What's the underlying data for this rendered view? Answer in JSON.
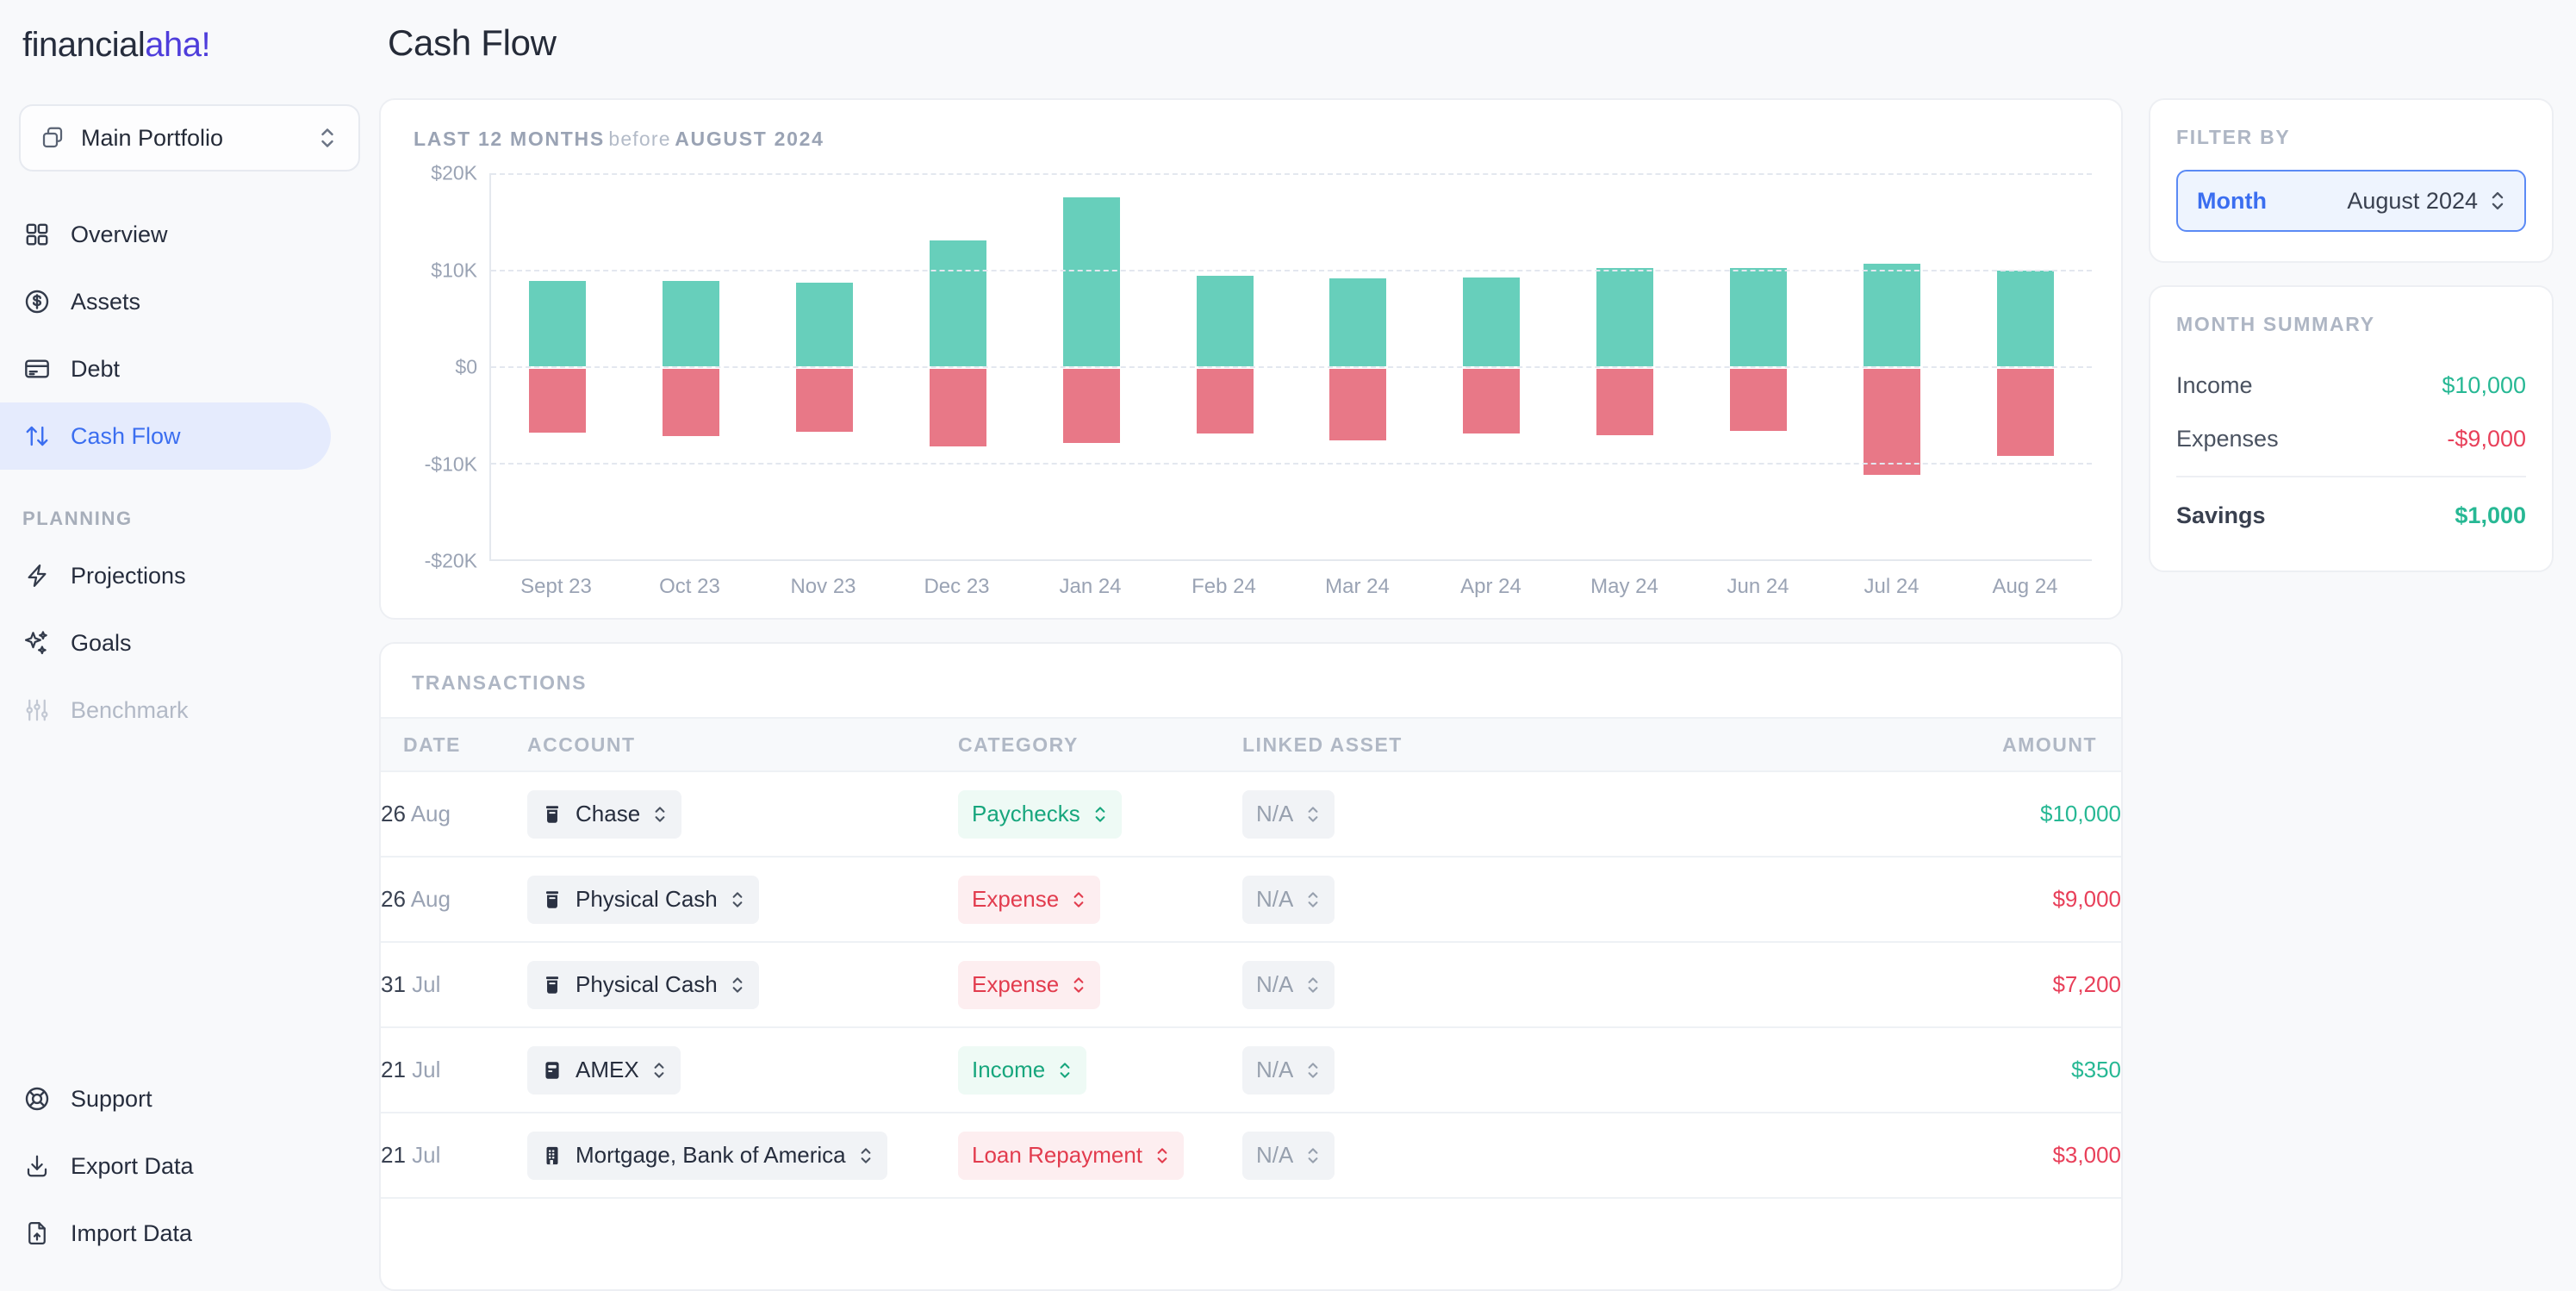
{
  "brand": {
    "name_part1": "financial",
    "name_part2": "aha!"
  },
  "portfolio_selector": {
    "label": "Main Portfolio",
    "icon": "copy-icon"
  },
  "sidebar": {
    "main_items": [
      {
        "label": "Overview",
        "icon": "grid-icon",
        "active": false
      },
      {
        "label": "Assets",
        "icon": "dollar-circle-icon",
        "active": false
      },
      {
        "label": "Debt",
        "icon": "credit-card-icon",
        "active": false
      },
      {
        "label": "Cash Flow",
        "icon": "arrows-up-down-icon",
        "active": true
      }
    ],
    "planning_title": "PLANNING",
    "planning_items": [
      {
        "label": "Projections",
        "icon": "lightning-icon",
        "disabled": false
      },
      {
        "label": "Goals",
        "icon": "sparkles-icon",
        "disabled": false
      },
      {
        "label": "Benchmark",
        "icon": "sliders-icon",
        "disabled": true
      }
    ],
    "bottom_items": [
      {
        "label": "Support",
        "icon": "lifebuoy-icon"
      },
      {
        "label": "Export Data",
        "icon": "download-icon"
      },
      {
        "label": "Import Data",
        "icon": "file-upload-icon"
      }
    ]
  },
  "header": {
    "page_title": "Cash Flow"
  },
  "chart_card": {
    "period_prefix": "LAST 12 MONTHS",
    "period_middle": "before",
    "period_suffix": "AUGUST 2024"
  },
  "chart_data": {
    "type": "bar",
    "title": "LAST 12 MONTHS before AUGUST 2024",
    "subtitle": "",
    "xlabel": "",
    "ylabel": "",
    "ylim": [
      -20000,
      20000
    ],
    "ytick_labels": [
      "$20K",
      "$10K",
      "$0",
      "-$10K",
      "-$20K"
    ],
    "ytick_values": [
      20000,
      10000,
      0,
      -10000,
      -20000
    ],
    "grid": true,
    "legend": "none",
    "stacked": "diverging",
    "categories": [
      "Sept 23",
      "Oct 23",
      "Nov 23",
      "Dec 23",
      "Jan 24",
      "Feb 24",
      "Mar 24",
      "Apr 24",
      "May 24",
      "Jun 24",
      "Jul 24",
      "Aug 24"
    ],
    "series": [
      {
        "name": "Income",
        "color": "#67cfbb",
        "values": [
          8800,
          8800,
          8700,
          13000,
          17500,
          9400,
          9100,
          9200,
          10200,
          10200,
          10600,
          9900
        ]
      },
      {
        "name": "Expenses",
        "color": "#e87887",
        "values": [
          -6600,
          -7000,
          -6500,
          -8000,
          -7700,
          -6700,
          -7400,
          -6700,
          -6900,
          -6400,
          -11000,
          -9000
        ]
      }
    ]
  },
  "transactions_card": {
    "title": "TRANSACTIONS",
    "columns": [
      "DATE",
      "ACCOUNT",
      "CATEGORY",
      "LINKED ASSET",
      "AMOUNT"
    ],
    "rows": [
      {
        "day": "26",
        "month": "Aug",
        "account": "Chase",
        "account_icon": "jar-icon",
        "category": "Paychecks",
        "category_type": "income",
        "linked_asset": "N/A",
        "amount": "$10,000",
        "amount_type": "positive"
      },
      {
        "day": "26",
        "month": "Aug",
        "account": "Physical Cash",
        "account_icon": "jar-icon",
        "category": "Expense",
        "category_type": "expense",
        "linked_asset": "N/A",
        "amount": "$9,000",
        "amount_type": "negative"
      },
      {
        "day": "31",
        "month": "Jul",
        "account": "Physical Cash",
        "account_icon": "jar-icon",
        "category": "Expense",
        "category_type": "expense",
        "linked_asset": "N/A",
        "amount": "$7,200",
        "amount_type": "negative"
      },
      {
        "day": "21",
        "month": "Jul",
        "account": "AMEX",
        "account_icon": "credit-card-icon",
        "category": "Income",
        "category_type": "income",
        "linked_asset": "N/A",
        "amount": "$350",
        "amount_type": "positive"
      },
      {
        "day": "21",
        "month": "Jul",
        "account": "Mortgage, Bank of America",
        "account_icon": "bank-icon",
        "category": "Loan Repayment",
        "category_type": "expense",
        "linked_asset": "N/A",
        "amount": "$3,000",
        "amount_type": "negative"
      }
    ]
  },
  "filter_panel": {
    "title": "FILTER BY",
    "filter_key": "Month",
    "filter_value": "August 2024"
  },
  "summary_panel": {
    "title": "MONTH SUMMARY",
    "income_label": "Income",
    "income_value": "$10,000",
    "expenses_label": "Expenses",
    "expenses_value": "-$9,000",
    "savings_label": "Savings",
    "savings_value": "$1,000"
  },
  "colors": {
    "accent_blue": "#3b6ef0",
    "brand_purple": "#4e3ddb",
    "positive_green": "#27b894",
    "negative_red": "#e8405a",
    "bar_green": "#67cfbb",
    "bar_red": "#e87887"
  }
}
